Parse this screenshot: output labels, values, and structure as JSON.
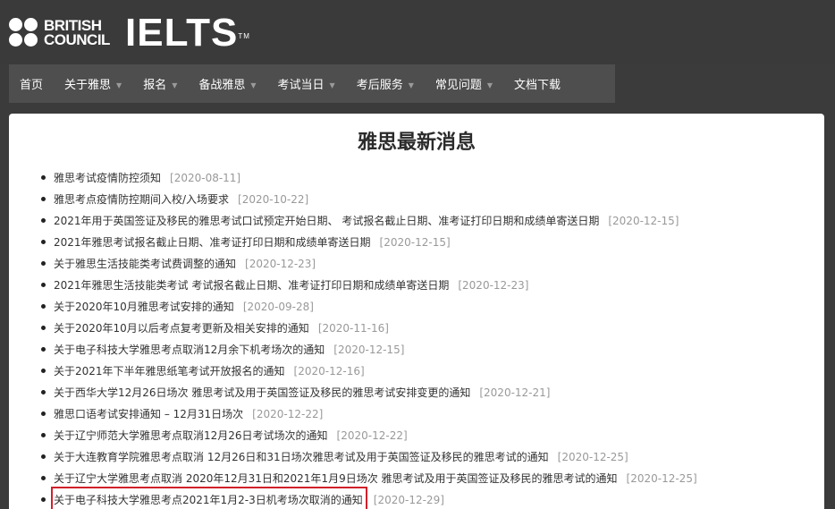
{
  "brand": {
    "bc_line1": "BRITISH",
    "bc_line2": "COUNCIL",
    "ielts": "IELTS",
    "tm": "TM"
  },
  "nav": {
    "items": [
      {
        "label": "首页",
        "has_dropdown": false
      },
      {
        "label": "关于雅思",
        "has_dropdown": true
      },
      {
        "label": "报名",
        "has_dropdown": true
      },
      {
        "label": "备战雅思",
        "has_dropdown": true
      },
      {
        "label": "考试当日",
        "has_dropdown": true
      },
      {
        "label": "考后服务",
        "has_dropdown": true
      },
      {
        "label": "常见问题",
        "has_dropdown": true
      },
      {
        "label": "文档下载",
        "has_dropdown": false
      }
    ]
  },
  "main": {
    "title": "雅思最新消息",
    "news": [
      {
        "text": "雅思考试疫情防控须知",
        "date": "[2020-08-11]"
      },
      {
        "text": "雅思考点疫情防控期间入校/入场要求",
        "date": "[2020-10-22]"
      },
      {
        "text": "2021年用于英国签证及移民的雅思考试口试预定开始日期、 考试报名截止日期、准考证打印日期和成绩单寄送日期",
        "date": "[2020-12-15]"
      },
      {
        "text": "2021年雅思考试报名截止日期、准考证打印日期和成绩单寄送日期",
        "date": "[2020-12-15]"
      },
      {
        "text": "关于雅思生活技能类考试费调整的通知",
        "date": "[2020-12-23]"
      },
      {
        "text": "2021年雅思生活技能类考试 考试报名截止日期、准考证打印日期和成绩单寄送日期",
        "date": "[2020-12-23]"
      },
      {
        "text": "关于2020年10月雅思考试安排的通知",
        "date": "[2020-09-28]"
      },
      {
        "text": "关于2020年10月以后考点复考更新及相关安排的通知",
        "date": "[2020-11-16]"
      },
      {
        "text": "关于电子科技大学雅思考点取消12月余下机考场次的通知",
        "date": "[2020-12-15]"
      },
      {
        "text": "关于2021年下半年雅思纸笔考试开放报名的通知",
        "date": "[2020-12-16]"
      },
      {
        "text": "关于西华大学12月26日场次 雅思考试及用于英国签证及移民的雅思考试安排变更的通知",
        "date": "[2020-12-21]"
      },
      {
        "text": "雅思口语考试安排通知 – 12月31日场次",
        "date": "[2020-12-22]"
      },
      {
        "text": "关于辽宁师范大学雅思考点取消12月26日考试场次的通知",
        "date": "[2020-12-22]"
      },
      {
        "text": "关于大连教育学院雅思考点取消 12月26日和31日场次雅思考试及用于英国签证及移民的雅思考试的通知",
        "date": "[2020-12-25]"
      },
      {
        "text": "关于辽宁大学雅思考点取消 2020年12月31日和2021年1月9日场次 雅思考试及用于英国签证及移民的雅思考试的通知",
        "date": "[2020-12-25]"
      },
      {
        "text": "关于电子科技大学雅思考点2021年1月2-3日机考场次取消的通知",
        "date": "[2020-12-29]",
        "highlighted": true
      }
    ]
  },
  "colors": {
    "header_bg": "#3a3a3a",
    "nav_bg": "#4e4e4e",
    "highlight_border": "#d0202a",
    "date_text": "#999999"
  }
}
